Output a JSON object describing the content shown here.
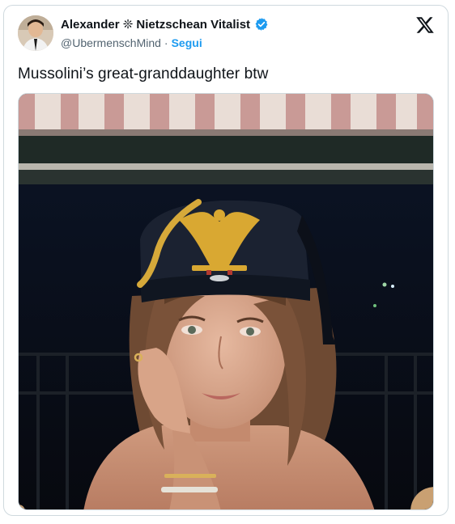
{
  "tweet": {
    "display_name": "Alexander ❊ Nietzschean Vitalist",
    "handle": "@UbermenschMind",
    "separator": "·",
    "follow_label": "Segui",
    "text": "Mussolini’s great-granddaughter btw"
  },
  "icons": {
    "verified": "verified-badge-icon",
    "brand": "x-logo-icon"
  },
  "colors": {
    "accent": "#1d9bf0",
    "text": "#0f1419",
    "muted": "#536471",
    "border": "#cfd9de"
  }
}
